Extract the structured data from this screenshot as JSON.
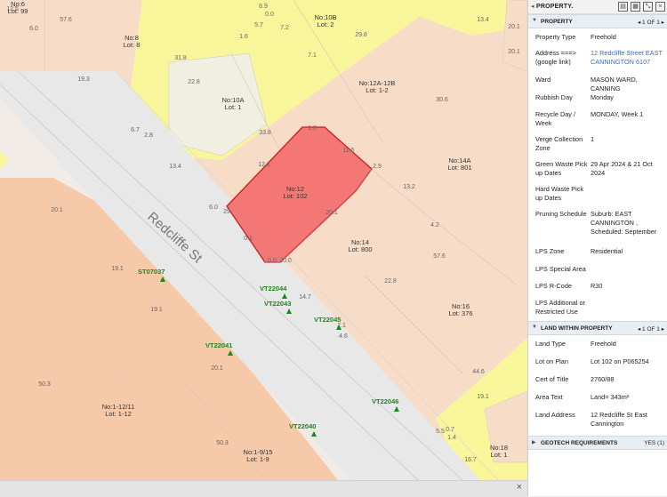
{
  "map": {
    "street_name": "Redcliffe St",
    "lots": [
      {
        "no": "No:6",
        "lot": "Lot: 99"
      },
      {
        "no": "No:8",
        "lot": "Lot: 8"
      },
      {
        "no": "No:10B",
        "lot": "Lot: 2"
      },
      {
        "no": "No:10A",
        "lot": "Lot: 1"
      },
      {
        "no": "No:12A-12B",
        "lot": "Lot: 1-2"
      },
      {
        "no": "No:12",
        "lot": "Lot: 102"
      },
      {
        "no": "No:14A",
        "lot": "Lot: 801"
      },
      {
        "no": "No:14",
        "lot": "Lot: 800"
      },
      {
        "no": "No:16",
        "lot": "Lot: 376"
      },
      {
        "no": "No:1-12/11",
        "lot": "Lot: 1-12"
      },
      {
        "no": "No:1-9/15",
        "lot": "Lot: 1-9"
      },
      {
        "no": "No:18",
        "lot": "Lot: 1"
      }
    ],
    "trees": [
      "ST07037",
      "VT22044",
      "VT22043",
      "VT22045",
      "VT22041",
      "VT22046",
      "VT22040"
    ],
    "dimensions": [
      "12.5",
      "6.0",
      "57.6",
      "8.9",
      "0.0",
      "13.4",
      "20.1",
      "20.1",
      "1.6",
      "5.7",
      "7.2",
      "29.8",
      "31.8",
      "7.1",
      "19.3",
      "22.8",
      "30.6",
      "6.7",
      "2.8",
      "33.8",
      "13.4",
      "12.1",
      "1.8",
      "11.5",
      "2.9",
      "13.2",
      "6.0",
      "29",
      "20.1",
      "4.2",
      "20.1",
      "0.1",
      "20.0",
      "57.6",
      "22.8",
      "19.1",
      "19.1",
      "14.7",
      "2.1",
      "4.6",
      "44.6",
      "20.1",
      "50.3",
      "19.1",
      "5.5",
      "0.7",
      "1.4",
      "50.3",
      "16.7",
      "0.0"
    ],
    "close_label": "×"
  },
  "panel": {
    "title": "PROPERTY.",
    "property_section": {
      "name": "PROPERTY",
      "pager": "1 OF 1",
      "rows": [
        {
          "key": "Property Type",
          "value": "Freehold"
        },
        {
          "key": "Address ===> (google link)",
          "value": "12 Redcliffe Street EAST CANNINGTON 6107"
        },
        {
          "key": "Ward",
          "value": "MASON WARD, CANNING"
        },
        {
          "key": "Rubbish Day",
          "value": "Monday"
        },
        {
          "key": "Recycle Day / Week",
          "value": "MONDAY, Week 1"
        },
        {
          "key": "Verge Collection Zone",
          "value": "1"
        },
        {
          "key": "Green Waste Pick up Dates",
          "value": "29 Apr 2024 & 21 Oct 2024"
        },
        {
          "key": "Hard Waste Pick up Dates",
          "value": ""
        },
        {
          "key": "Pruning Schedule",
          "value": "Suburb: EAST CANNINGTON , Scheduled: September"
        },
        {
          "key": "LPS Zone",
          "value": "Residential"
        },
        {
          "key": "LPS Special Area",
          "value": ""
        },
        {
          "key": "LPS R-Code",
          "value": "R30"
        },
        {
          "key": "LPS Additional or Restricted Use",
          "value": ""
        }
      ]
    },
    "land_section": {
      "name": "LAND WITHIN PROPERTY",
      "pager": "1 OF 1",
      "rows": [
        {
          "key": "Land Type",
          "value": "Freehold"
        },
        {
          "key": "Lot on Plan",
          "value": "Lot 102 on P065254"
        },
        {
          "key": "Cert of Title",
          "value": "2760/88"
        },
        {
          "key": "Area Text",
          "value": "Land= 343m²"
        },
        {
          "key": "Land Address",
          "value": "12 Redcliffe St East Cannington"
        }
      ]
    },
    "geotech_section": {
      "name": "GEOTECH REQUIREMENTS",
      "status": "YES (1)"
    },
    "colors": {
      "highlight": "#f36b6b",
      "residential": "#f8d9c4",
      "zone_yellow": "#f9f59b",
      "link": "#2a6fc9"
    }
  }
}
